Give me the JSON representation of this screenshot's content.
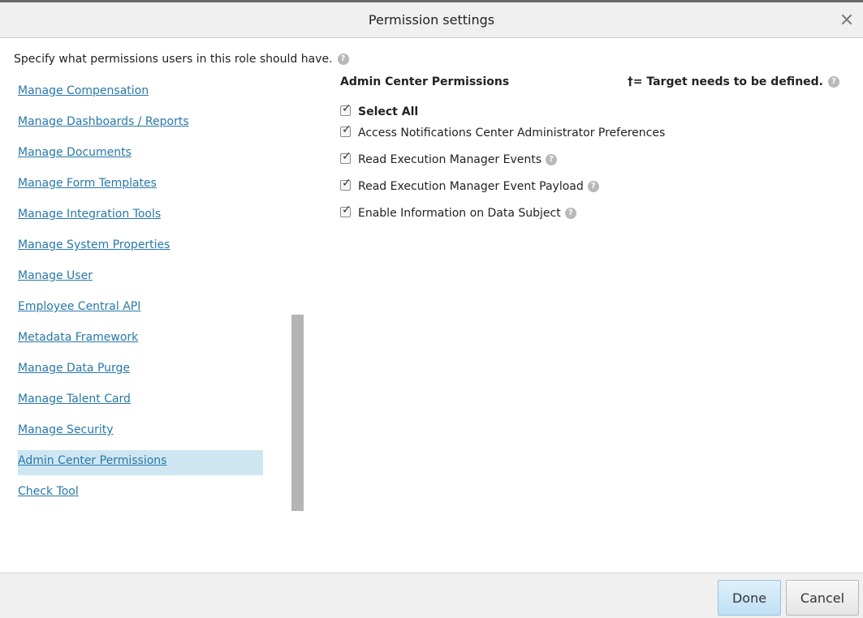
{
  "dialog": {
    "title": "Permission settings",
    "intro": "Specify what permissions users in this role should have.",
    "help_glyph": "?"
  },
  "sidebar": {
    "items": [
      {
        "label": "Manage Compensation",
        "active": false
      },
      {
        "label": "Manage Dashboards / Reports",
        "active": false
      },
      {
        "label": "Manage Documents",
        "active": false
      },
      {
        "label": "Manage Form Templates",
        "active": false
      },
      {
        "label": "Manage Integration Tools",
        "active": false
      },
      {
        "label": "Manage System Properties",
        "active": false
      },
      {
        "label": "Manage User",
        "active": false
      },
      {
        "label": "Employee Central API",
        "active": false
      },
      {
        "label": "Metadata Framework",
        "active": false
      },
      {
        "label": "Manage Data Purge",
        "active": false
      },
      {
        "label": "Manage Talent Card",
        "active": false
      },
      {
        "label": "Manage Security",
        "active": false
      },
      {
        "label": "Admin Center Permissions",
        "active": true
      },
      {
        "label": "Check Tool",
        "active": false
      }
    ]
  },
  "panel": {
    "title": "Admin Center Permissions",
    "target_note": "†= Target needs to be defined.",
    "permissions": [
      {
        "label": "Select All",
        "checked": true,
        "help": false
      },
      {
        "label": "Access Notifications Center Administrator Preferences",
        "checked": true,
        "help": false
      },
      {
        "label": "Read Execution Manager Events",
        "checked": true,
        "help": true
      },
      {
        "label": "Read Execution Manager Event Payload",
        "checked": true,
        "help": true
      },
      {
        "label": "Enable Information on Data Subject",
        "checked": true,
        "help": true
      }
    ]
  },
  "footer": {
    "done_label": "Done",
    "cancel_label": "Cancel"
  },
  "colors": {
    "link": "#2878a8",
    "active_row": "#cde6f2",
    "titlebar": "#f0f0f0"
  }
}
